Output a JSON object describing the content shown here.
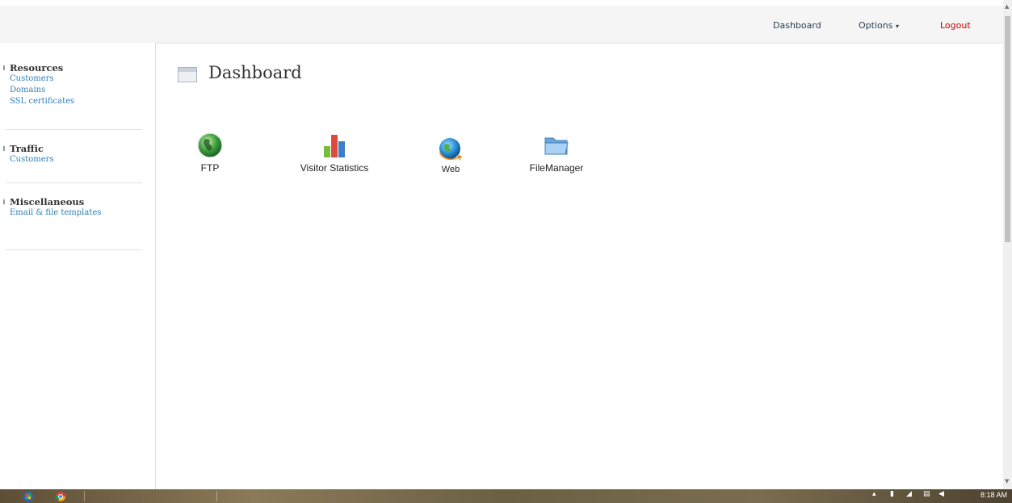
{
  "topnav": {
    "dashboard": "Dashboard",
    "options": "Options",
    "options_caret": "▾",
    "logout": "Logout"
  },
  "sidebar": {
    "sections": [
      {
        "title": "Resources",
        "links": [
          "Customers",
          "Domains",
          "SSL certificates"
        ]
      },
      {
        "title": "Traffic",
        "links": [
          "Customers"
        ]
      },
      {
        "title": "Miscellaneous",
        "links": [
          "Email & file templates"
        ]
      }
    ]
  },
  "page": {
    "title": "Dashboard"
  },
  "tiles": [
    {
      "label": "FTP",
      "icon": "globe-icon"
    },
    {
      "label": "Visitor Statistics",
      "icon": "bar-chart-icon"
    },
    {
      "label": "Web",
      "icon": "web-globe-icon"
    },
    {
      "label": "FileManager",
      "icon": "folder-icon"
    }
  ],
  "taskbar": {
    "clock": "8:18 AM"
  },
  "colors": {
    "link": "#2f7fb8",
    "logout": "#cc0000",
    "topbar": "#f5f5f5"
  }
}
